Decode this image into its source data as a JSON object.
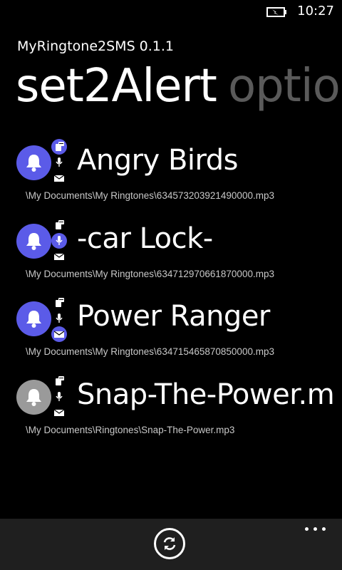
{
  "status": {
    "time": "10:27",
    "icon": "battery-charging-icon"
  },
  "app": {
    "title": "MyRingtone2SMS 0.1.1"
  },
  "pivot": {
    "active": "set2Alert",
    "inactive": "options"
  },
  "colors": {
    "accent": "#5b5be8",
    "inactive": "#9a9a9a",
    "background": "#000000",
    "app_bar": "#1f1f1f"
  },
  "items": [
    {
      "title": "Angry Birds",
      "path": "\\My Documents\\My Ringtones\\634573203921490000.mp3",
      "enabled": true,
      "sms_active": true,
      "voice_active": false,
      "email_active": false
    },
    {
      "title": "-car Lock-",
      "path": "\\My Documents\\My Ringtones\\634712970661870000.mp3",
      "enabled": true,
      "sms_active": false,
      "voice_active": true,
      "email_active": false
    },
    {
      "title": "Power Ranger",
      "path": "\\My Documents\\My Ringtones\\634715465870850000.mp3",
      "enabled": true,
      "sms_active": false,
      "voice_active": false,
      "email_active": true
    },
    {
      "title": "Snap-The-Power.m",
      "path": "\\My Documents\\Ringtones\\Snap-The-Power.mp3",
      "enabled": false,
      "sms_active": false,
      "voice_active": false,
      "email_active": false
    }
  ],
  "appbar": {
    "refresh_icon": "refresh-icon",
    "more_icon": "more-ellipsis-icon"
  }
}
